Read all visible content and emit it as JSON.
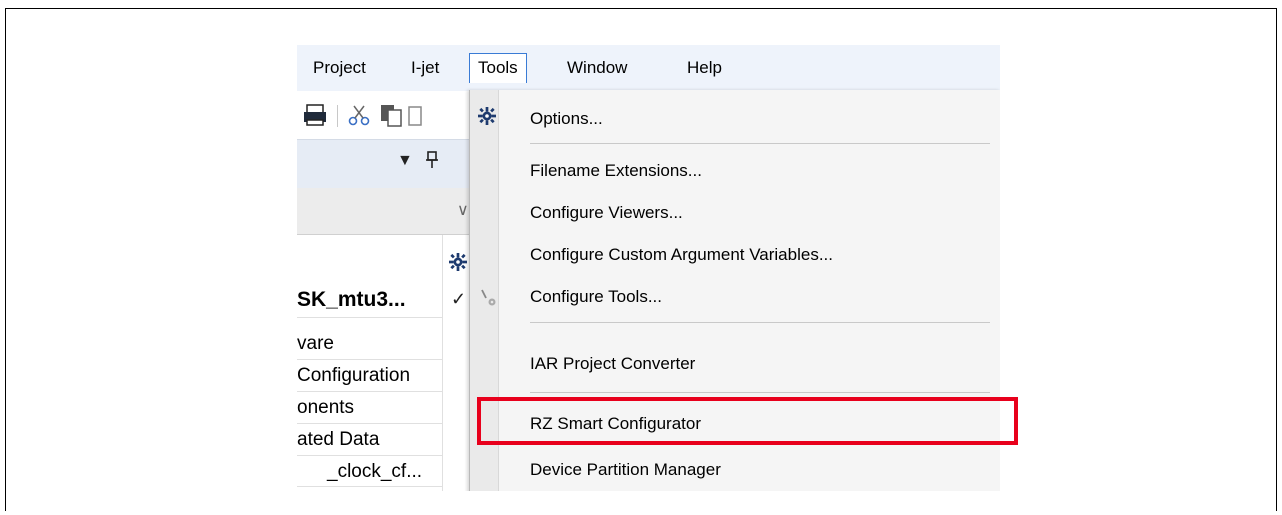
{
  "menubar": {
    "items": [
      {
        "label": "Project"
      },
      {
        "label": "I-jet"
      },
      {
        "label": "Tools"
      },
      {
        "label": "Window"
      },
      {
        "label": "Help"
      }
    ]
  },
  "toolbar": {
    "icons": [
      "print-icon",
      "cut-icon",
      "copy-icon",
      "paste-icon"
    ]
  },
  "panel": {
    "dropdown_arrow": "▼",
    "pin_glyph": "ꟷ",
    "combo_arrow": "∨",
    "tree": [
      {
        "label": "SK_mtu3...",
        "check": "✓"
      },
      {
        "label": "vare"
      },
      {
        "label": "Configuration"
      },
      {
        "label": "onents"
      },
      {
        "label": "ated Data"
      },
      {
        "label": "_clock_cf..."
      }
    ]
  },
  "tools_menu": {
    "items": [
      {
        "label": "Options...",
        "icon": "gear-icon"
      },
      {
        "label": "Filename Extensions..."
      },
      {
        "label": "Configure Viewers..."
      },
      {
        "label": "Configure Custom Argument Variables..."
      },
      {
        "label": "Configure Tools...",
        "icon": "tools-icon"
      },
      {
        "label": "IAR Project Converter"
      },
      {
        "label": "RZ Smart Configurator"
      },
      {
        "label": "Device Partition Manager"
      }
    ]
  },
  "colors": {
    "highlight": "#e8001c",
    "menubar_bg": "#eef3fb",
    "active_menu_border": "#3a7bd5"
  }
}
